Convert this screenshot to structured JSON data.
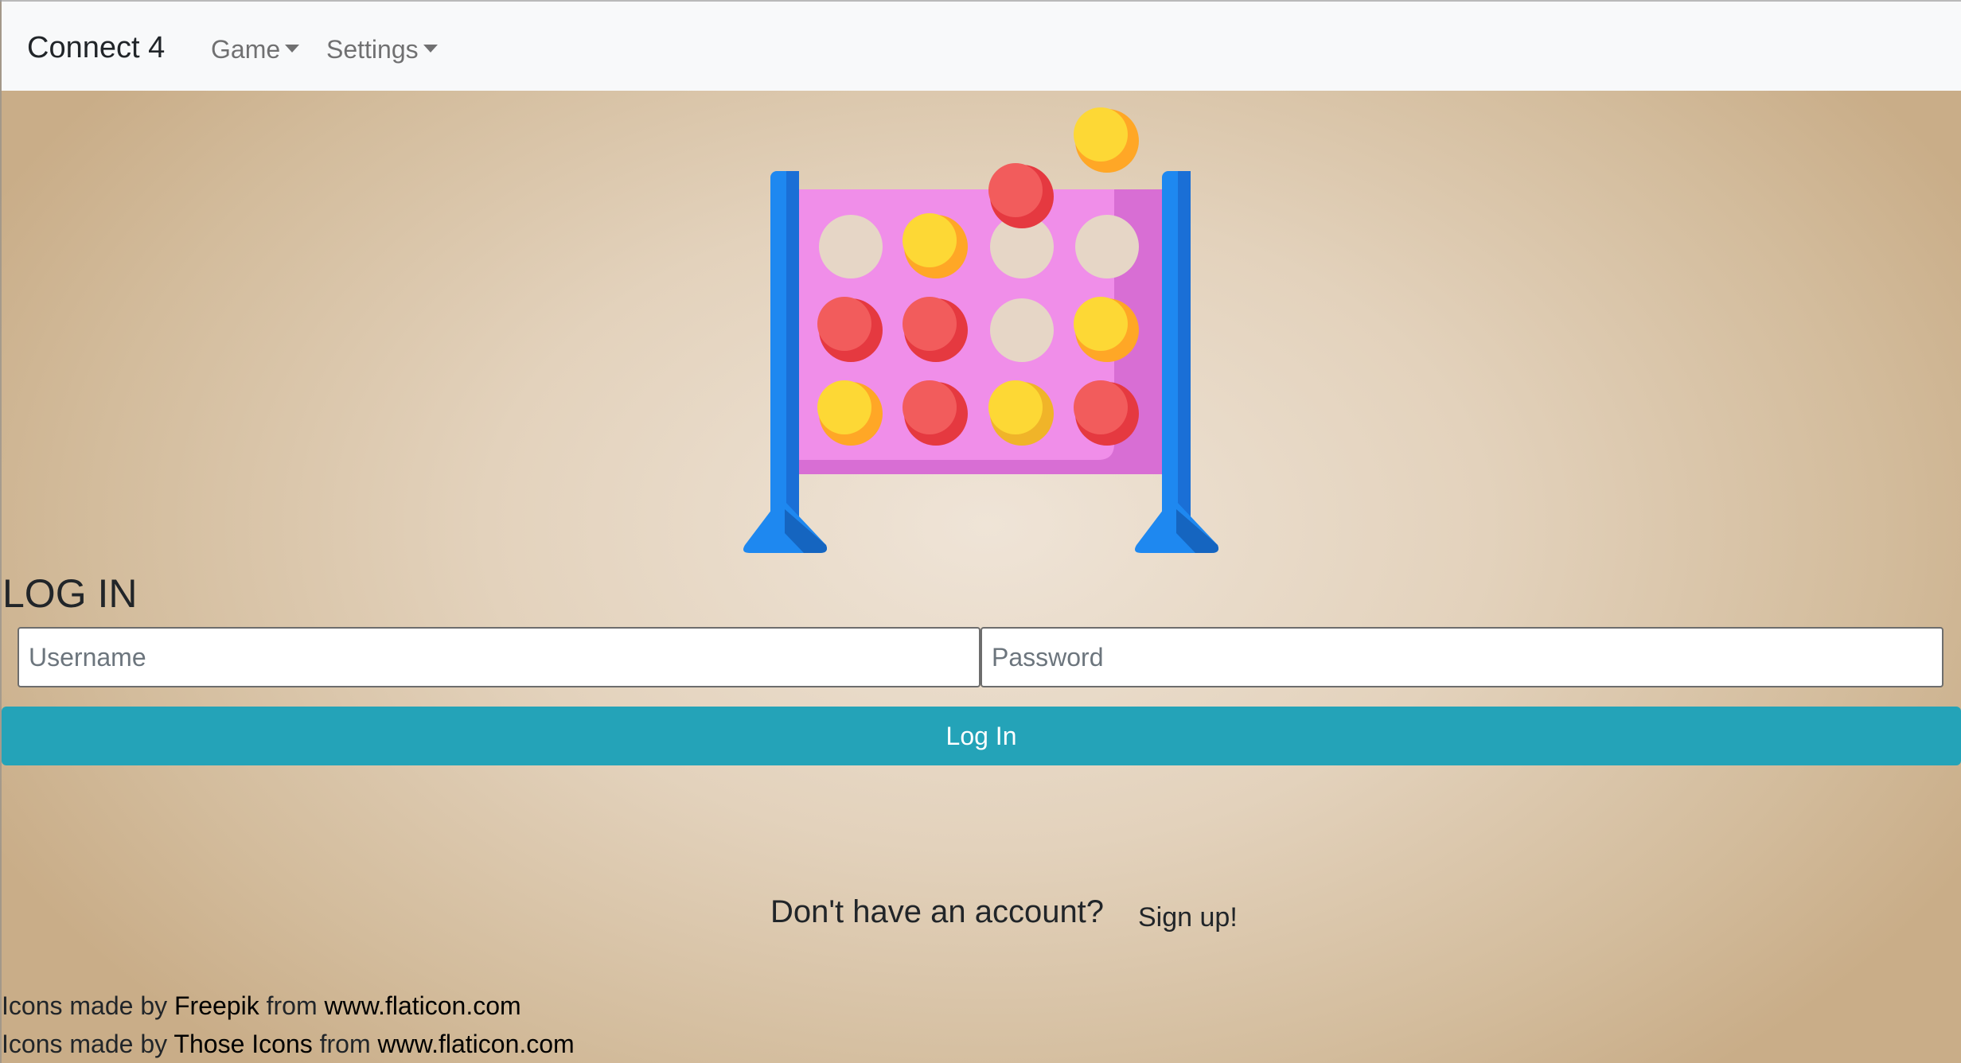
{
  "navbar": {
    "brand": "Connect 4",
    "items": [
      {
        "label": "Game",
        "has_dropdown": true
      },
      {
        "label": "Settings",
        "has_dropdown": true
      }
    ]
  },
  "hero": {
    "icon": "connect-four-game-illustration",
    "colors": {
      "frame": "#1e88f0",
      "board": "#f08ee9",
      "board_shade": "#d86ed4",
      "empty_slot": "#e6d6c6",
      "red": "#ea4a4c",
      "yellow": "#fdd835"
    }
  },
  "login": {
    "heading": "LOG IN",
    "username_placeholder": "Username",
    "password_placeholder": "Password",
    "submit_label": "Log In",
    "button_color": "#24a3b8"
  },
  "signup": {
    "prompt": "Don't have an account?",
    "link": "Sign up!"
  },
  "credits": [
    {
      "prefix": "Icons made by ",
      "author": "Freepik",
      "middle": " from ",
      "site": "www.flaticon.com"
    },
    {
      "prefix": "Icons made by ",
      "author": "Those Icons",
      "middle": " from ",
      "site": "www.flaticon.com"
    }
  ]
}
